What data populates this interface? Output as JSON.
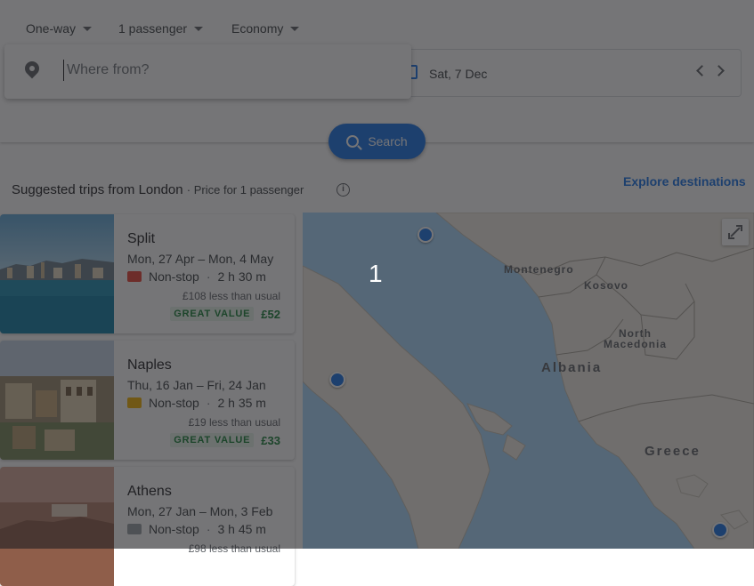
{
  "search": {
    "trip_type": "One-way",
    "passengers": "1 passenger",
    "cabin": "Economy",
    "from_placeholder": "Where from?",
    "departure_date": "Sat, 7 Dec",
    "search_label": "Search"
  },
  "suggestions": {
    "title": "Suggested trips from London",
    "subtitle": "· Price for 1 passenger",
    "explore_label": "Explore destinations",
    "cards": [
      {
        "city": "Split",
        "dates": "Mon, 27 Apr – Mon, 4 May",
        "stops": "Non-stop",
        "duration": "2 h 30 m",
        "saving": "£108 less than usual",
        "badge": "GREAT VALUE",
        "price": "£52"
      },
      {
        "city": "Naples",
        "dates": "Thu, 16 Jan – Fri, 24 Jan",
        "stops": "Non-stop",
        "duration": "2 h 35 m",
        "saving": "£19 less than usual",
        "badge": "GREAT VALUE",
        "price": "£33"
      },
      {
        "city": "Athens",
        "dates": "Mon, 27 Jan – Mon, 3 Feb",
        "stops": "Non-stop",
        "duration": "3 h 45 m",
        "saving": "£98 less than usual",
        "badge": "",
        "price": ""
      }
    ]
  },
  "map": {
    "labels": {
      "montenegro": "Montenegro",
      "kosovo": "Kosovo",
      "north_macedonia": "North\nMacedonia",
      "albania": "Albania",
      "greece": "Greece"
    }
  },
  "overlay": {
    "step": "1"
  },
  "colors": {
    "accent": "#1a73e8",
    "great_value": "#188038",
    "overlay": "rgba(32,33,36,.62)"
  }
}
